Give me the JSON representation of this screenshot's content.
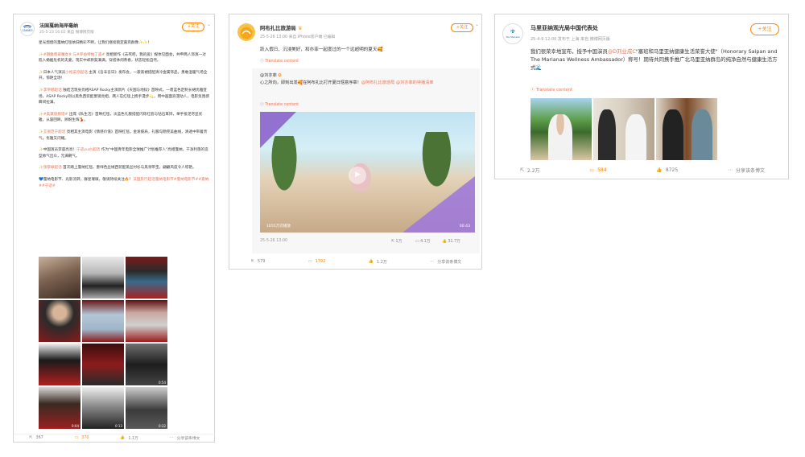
{
  "posts": [
    {
      "account": "法国戛纳海岸毫纳",
      "meta": "25-5-23 16:02  来自 微博网页版",
      "text": {
        "p1": "星光熠熠的戛纳红毯依旧精彩不断，让我们继续锁定嘉宾群像✨✨！",
        "p2a": "✨#朗雅翡翠魔女# 与",
        "p2b": "#罗伯特帕丁森#",
        "p2c": " 亮相新作《去死吧，我的爱》媒体见面会，共申两人饰演一对陷入婚姻危机的夫妻，现实中却默契满满，穿搭休闲青春，状态轻松自然。",
        "p3a": "✨日本人气演员",
        "p3b": "小松菜奈超话",
        "p3c": " 主演《吾辛吾日》发布会，一袭黑裙搭配清冷金属饰品，勇敢温暖气场全开，惊艳全场！",
        "p4a": "✨",
        "p4b": "李宰赫超话",
        "p4c": " 独结洁现身亮相ASAP Rocky主演新片《天国与地狱》首映式，一裹蓝色定制长裙优雅登场，ASAP Rocky则以黑色西装配墨镜亮相，两人在红毯上携手漫步💫，用中画面浪漫动人，电影氛围感瞬间拉满。",
        "p5a": "✨",
        "p5b": "#奥黛丽赫塔#",
        "p5c": " 出席《私生活》首映红毯，淡蓝色礼服搭配闪烁红唇与钻石耳饰，举手投足尽显优雅，从容回眸，顾盼生辉💃。",
        "p6a": "✨",
        "p6b": "艾丽范宁超话",
        "p6c": " 亮相其主演电影《情感价值》首映红毯，金发披肩，礼服勾勒完美曲线，清透中带着贵气，优雅又闪耀。",
        "p7a": "✨中国演员李晨亮亮！",
        "p7b": "于适yush超话",
        "p7c": " 作为\"中国青年电影全球推广计划推荐人\"亮相戛纳，干净利落的造型帅气出众，元满朝气。",
        "p8a": "✨",
        "p8b": "张蔡峥超话",
        "p8c": " 首次踏上戛纳红毯，墨绿色丝绒西装配黑丝衬衫与黑领带宝，翩翩风度令人惊艳。",
        "p9a": "💙戛纳电影节、光影流转，群星璀璨，敬请持续关注🔥！",
        "p9b": "法国旅行超话",
        "p9c": "戛纳电影节#戛纳电影节##嘉纳##于适#"
      },
      "translate": "Translate content",
      "stats": {
        "share": "367",
        "comment": "370",
        "like": "1.1万"
      }
    },
    {
      "account": "阿布扎比旅游局",
      "meta": "25-5-26 13:00  来自 iPhone客户端  已编辑",
      "text": "跃入假日、沉浸美好，和亦菲一起度过的一个远超明的夏天🥰",
      "translate": "Translate content",
      "repost": {
        "author": "@刘亦菲",
        "text_a": "心之所向，即刻出发🥰在阿布扎比打开夏日惬意序章！",
        "text_b": "@阿布扎比旅游局 @刘亦菲的待播清单",
        "translate": "Translate content",
        "video_views": "1655万次播放",
        "video_time": "00:43",
        "meta": "25-5-26 13:00",
        "stats": {
          "share": "1万",
          "comment": "4.1万",
          "like": "31.7万"
        }
      },
      "stats": {
        "share": "579",
        "comment": "1792",
        "like": "1.2万",
        "more": "分享该条博文"
      }
    },
    {
      "account": "马里亚纳观光局中国代表处",
      "meta": "25-4-9 12:00  发布于 上海  来自 微博网页版",
      "text_a": "我们很荣幸地宣布，授予中国演员",
      "text_b": "@D刘业成C",
      "text_c": "\"塞班和马里亚纳健康生活荣誉大使\"（Honorary Saipan and The Marianas Wellness Ambassador）称号！期待共同携手推广北马里亚纳群岛的纯净自然与健康生活方式🌊",
      "translate": "Translate content",
      "stats": {
        "share": "2.2万",
        "comment": "584",
        "like": "8725",
        "more": "分享该条博文"
      }
    }
  ],
  "follow_label": "+关注",
  "avatar_logo_1": "CANNES",
  "avatar_logo_3": "The Marianas",
  "colors": {
    "accent": "#ff8200",
    "link": "#eb7350",
    "border": "#d4d4d4"
  },
  "icons": [
    "share-icon",
    "comment-icon",
    "like-icon",
    "more-icon",
    "play-icon",
    "translate-icon",
    "verified-icon"
  ]
}
